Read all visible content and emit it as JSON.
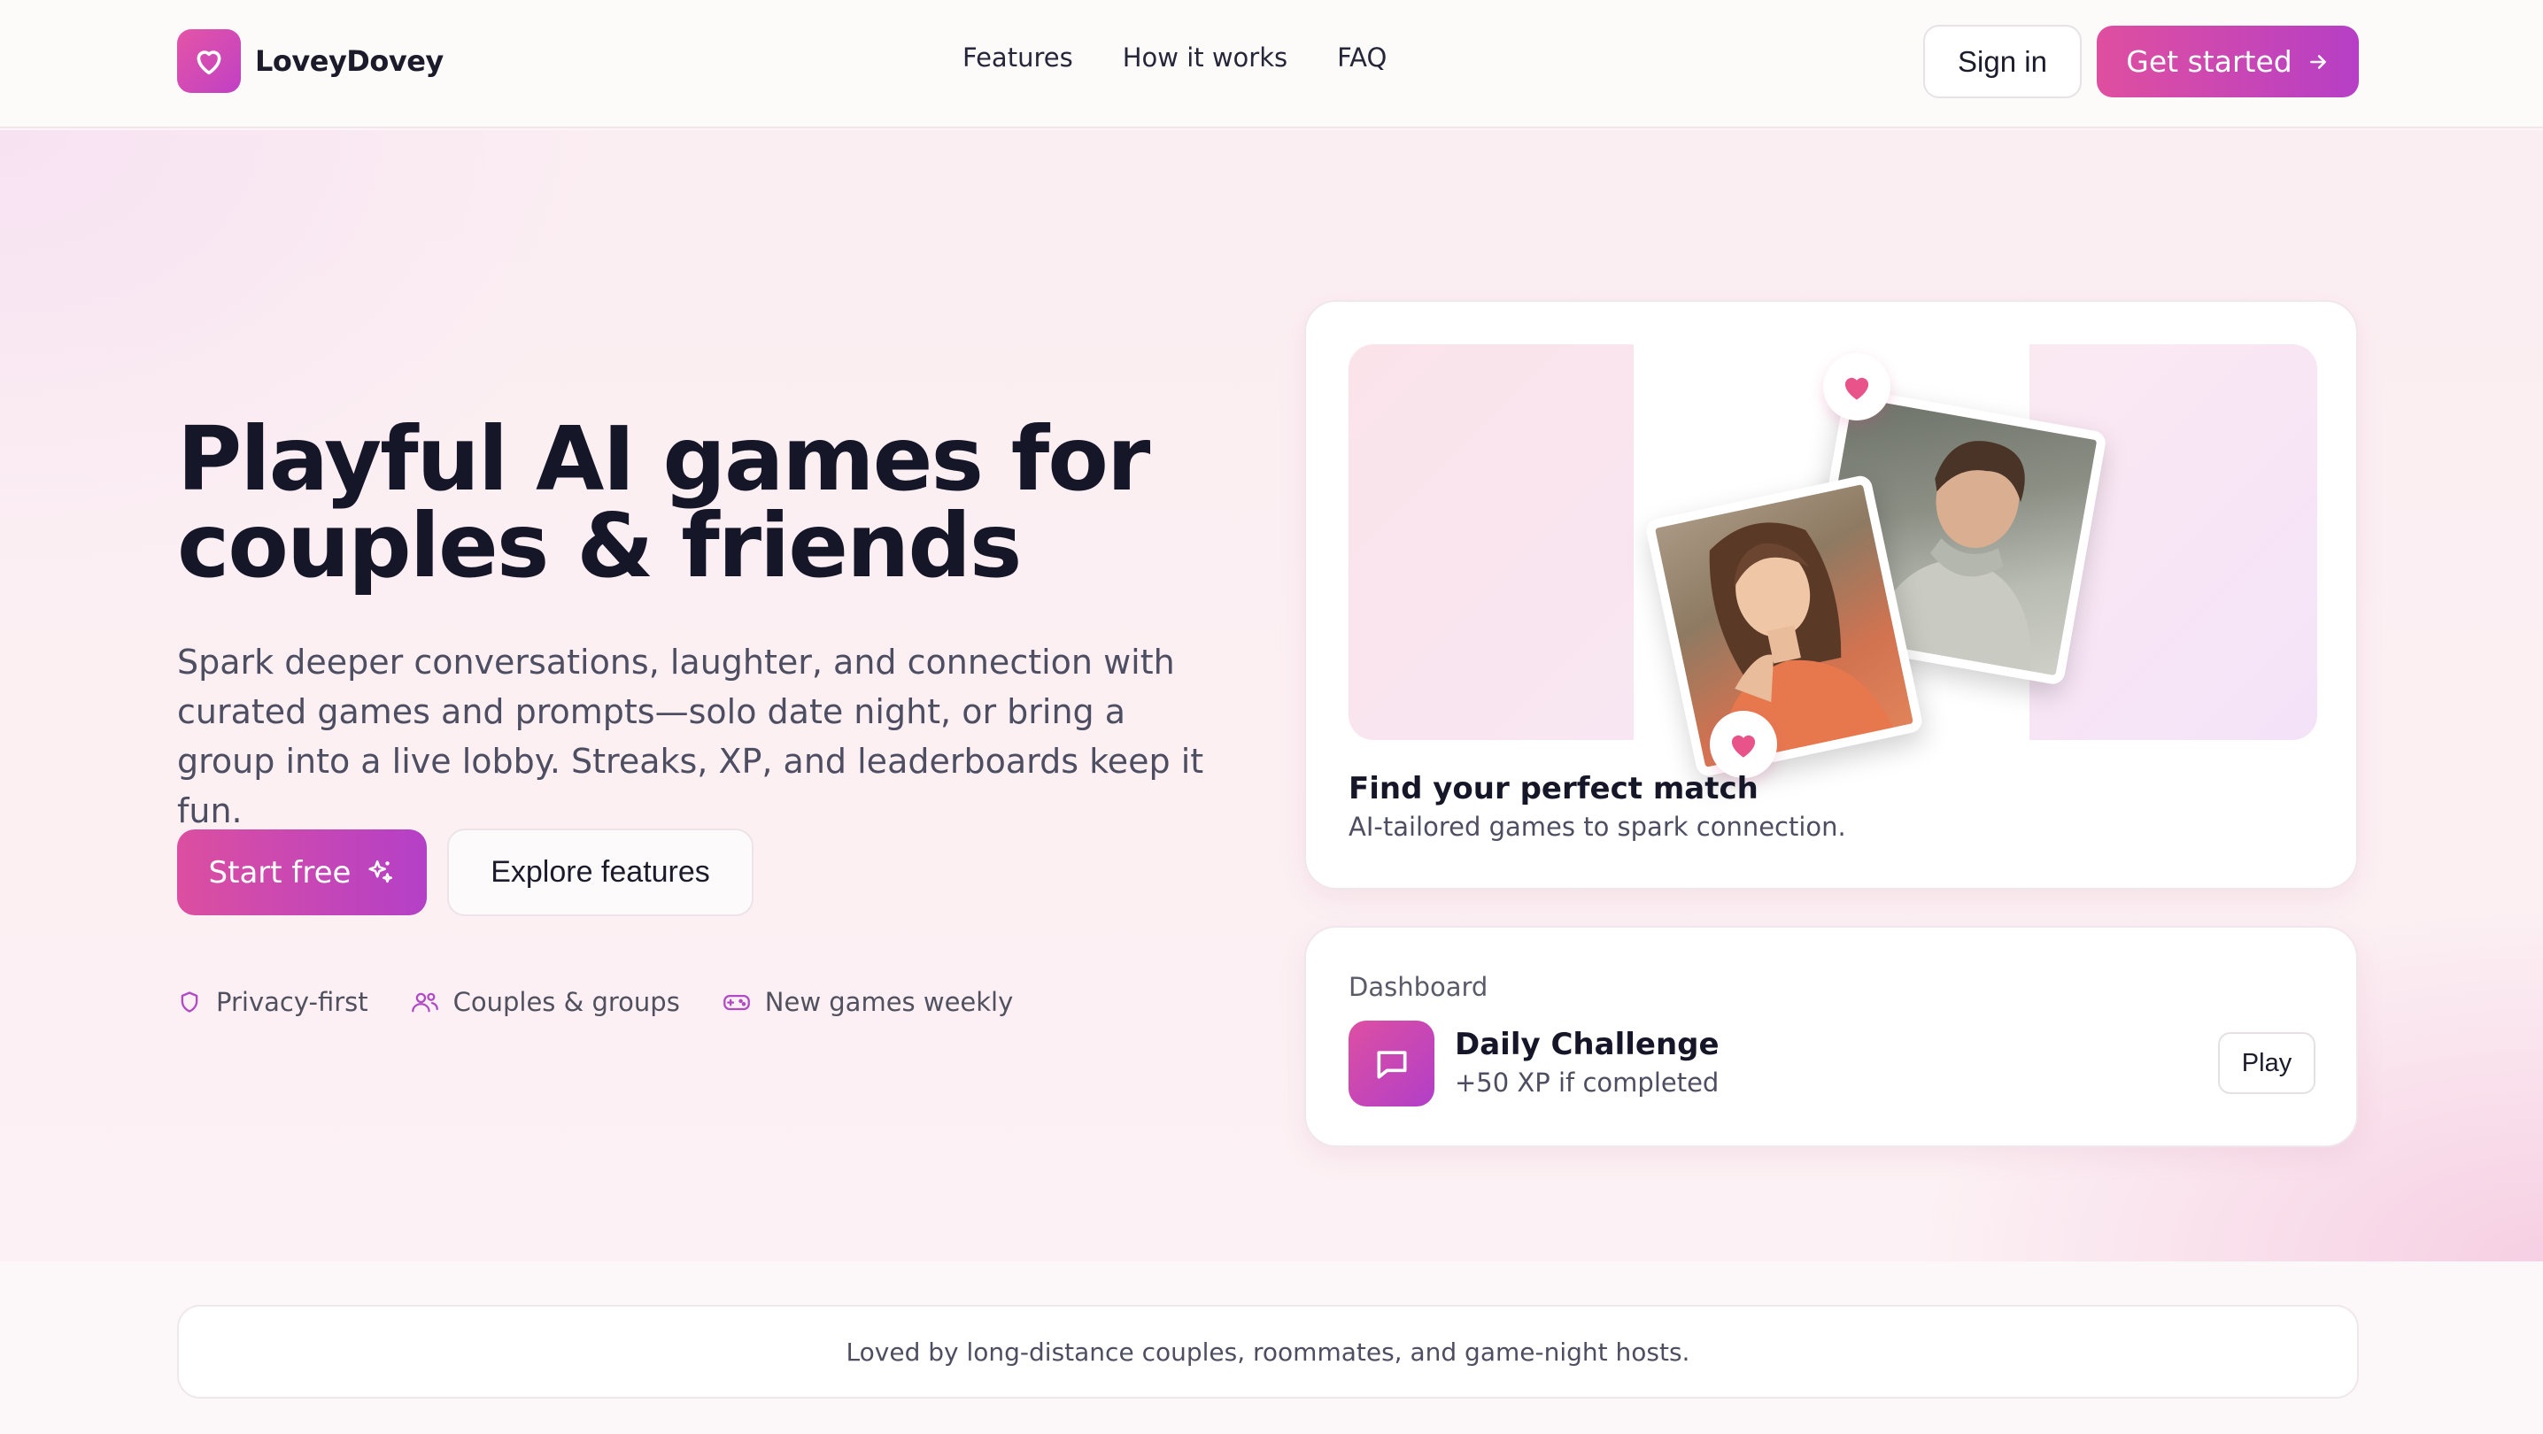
{
  "brand": {
    "name": "LoveyDovey",
    "logo_icon": "heart-icon",
    "accent": "#d84ca6"
  },
  "nav": {
    "links": [
      "Features",
      "How it works",
      "FAQ"
    ],
    "signin_label": "Sign in",
    "get_started_label": "Get started"
  },
  "hero": {
    "headline_line1": "Playful AI games for",
    "headline_line2": "couples & friends",
    "subtext": "Spark deeper conversations, laughter, and connection with curated games and prompts—solo date night, or bring a group into a live lobby. Streaks, XP, and leaderboards keep it fun.",
    "start_label": "Start free",
    "explore_label": "Explore features",
    "badges": [
      {
        "icon": "shield-icon",
        "label": "Privacy-first"
      },
      {
        "icon": "users-icon",
        "label": "Couples & groups"
      },
      {
        "icon": "gamepad-icon",
        "label": "New games weekly"
      }
    ]
  },
  "match_card": {
    "title": "Find your perfect match",
    "subtitle": "AI-tailored games to spark connection."
  },
  "dashboard_card": {
    "label": "Dashboard",
    "title": "Daily Challenge",
    "subtitle": "+50 XP if completed",
    "play_label": "Play"
  },
  "strip": {
    "text": "Loved by long-distance couples, roommates, and game-night hosts."
  }
}
